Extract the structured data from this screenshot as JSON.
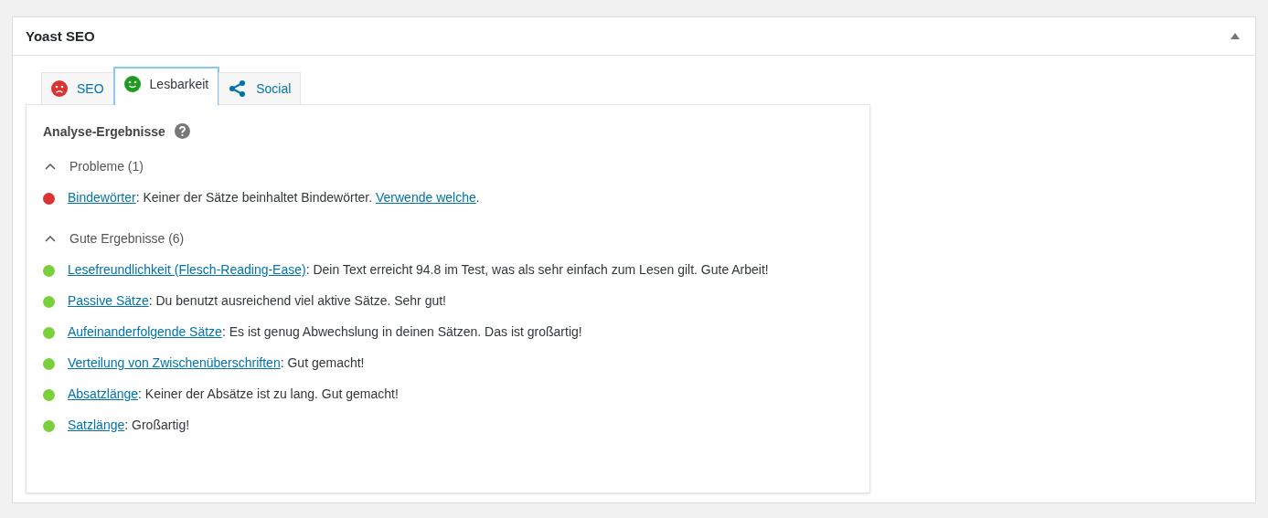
{
  "panel": {
    "title": "Yoast SEO",
    "expanded": true
  },
  "tabs": [
    {
      "label": "SEO",
      "kind": "sad",
      "selected": false
    },
    {
      "label": "Lesbarkeit",
      "kind": "smile",
      "selected": true
    },
    {
      "label": "Social",
      "kind": "share",
      "selected": false
    }
  ],
  "analysis": {
    "title": "Analyse-Ergebnisse",
    "sections": [
      {
        "title": "Probleme (1)",
        "expanded": true,
        "items": [
          {
            "color": "#dc3232",
            "parts": [
              {
                "kind": "link",
                "text": "Bindewörter"
              },
              {
                "kind": "text",
                "text": ": Keiner der Sätze beinhaltet Bindewörter. "
              },
              {
                "kind": "link",
                "text": "Verwende welche"
              },
              {
                "kind": "text",
                "text": "."
              }
            ]
          }
        ]
      },
      {
        "title": "Gute Ergebnisse (6)",
        "expanded": true,
        "items": [
          {
            "color": "#7ad03a",
            "parts": [
              {
                "kind": "link",
                "text": "Lesefreundlichkeit (Flesch-Reading-Ease)"
              },
              {
                "kind": "text",
                "text": ": Dein Text erreicht 94.8 im Test, was als sehr einfach zum Lesen gilt. Gute Arbeit!"
              }
            ]
          },
          {
            "color": "#7ad03a",
            "parts": [
              {
                "kind": "link",
                "text": "Passive Sätze"
              },
              {
                "kind": "text",
                "text": ": Du benutzt ausreichend viel aktive Sätze. Sehr gut!"
              }
            ]
          },
          {
            "color": "#7ad03a",
            "parts": [
              {
                "kind": "link",
                "text": "Aufeinanderfolgende Sätze"
              },
              {
                "kind": "text",
                "text": ": Es ist genug Abwechslung in deinen Sätzen. Das ist großartig!"
              }
            ]
          },
          {
            "color": "#7ad03a",
            "parts": [
              {
                "kind": "link",
                "text": "Verteilung von Zwischenüberschriften"
              },
              {
                "kind": "text",
                "text": ": Gut gemacht!"
              }
            ]
          },
          {
            "color": "#7ad03a",
            "parts": [
              {
                "kind": "link",
                "text": "Absatzlänge"
              },
              {
                "kind": "text",
                "text": ": Keiner der Absätze ist zu lang. Gut gemacht!"
              }
            ]
          },
          {
            "color": "#7ad03a",
            "parts": [
              {
                "kind": "link",
                "text": "Satzlänge"
              },
              {
                "kind": "text",
                "text": ": Großartig!"
              }
            ]
          }
        ]
      }
    ]
  }
}
